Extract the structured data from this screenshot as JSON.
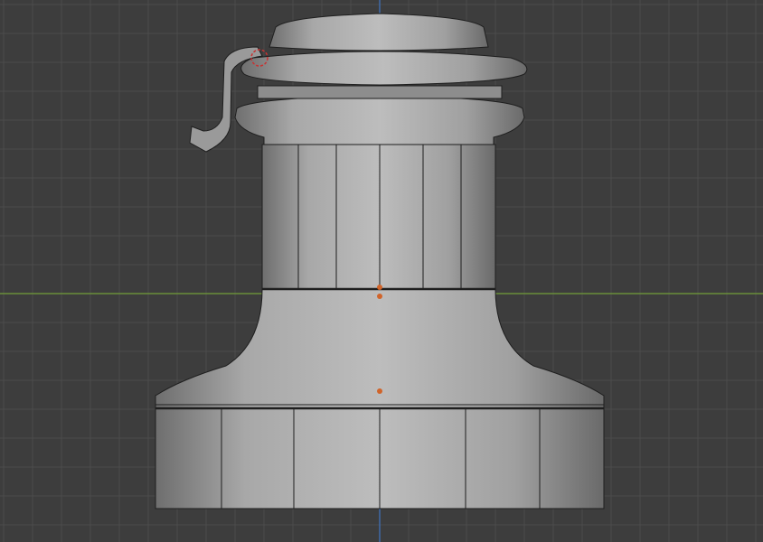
{
  "viewport": {
    "view": "3d-viewport-front-orthographic",
    "object": "winch-mesh",
    "mode": "wireframe-overlay",
    "colors": {
      "background": "#3d3d3d",
      "grid": "#4a4a4a",
      "x_axis": "#6a8f3a",
      "z_axis": "#3f6aa8",
      "mesh_fill": "#a9a9a9",
      "mesh_edge": "#1e1e1e",
      "origin_point": "#d0642a",
      "cursor": "#c83232"
    }
  }
}
